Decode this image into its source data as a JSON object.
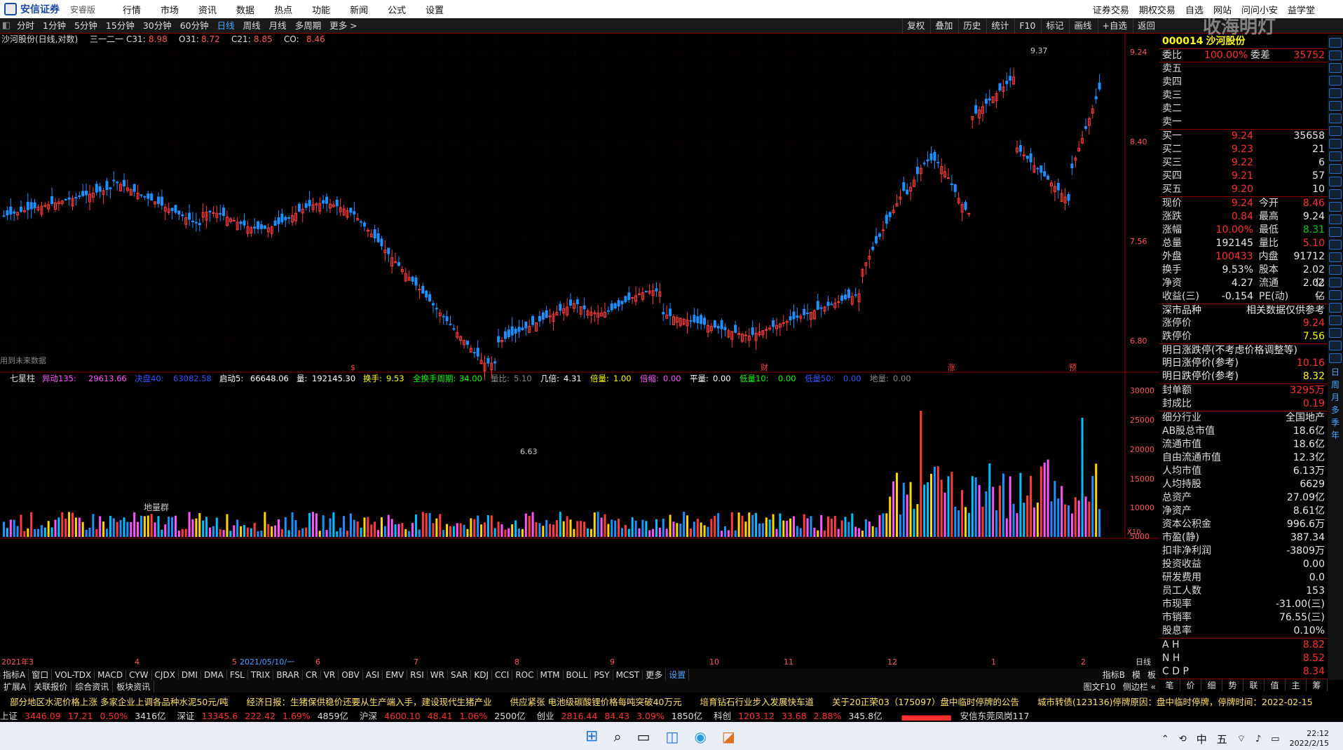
{
  "app": {
    "brand": "安信证券",
    "edition": "安睿版",
    "watermark": "收海明灯"
  },
  "menu": {
    "left": [
      "行情",
      "市场",
      "资讯",
      "数据",
      "热点",
      "功能",
      "新闻",
      "公式",
      "设置"
    ],
    "right": [
      "证券交易",
      "期权交易",
      "自选",
      "网站",
      "问问小安",
      "益学堂"
    ]
  },
  "toolbar": {
    "periods": [
      "分时",
      "1分钟",
      "5分钟",
      "15分钟",
      "30分钟",
      "60分钟",
      "日线",
      "周线",
      "月线",
      "多周期",
      "更多 >"
    ],
    "active": "日线",
    "right": [
      "复权",
      "叠加",
      "历史",
      "统计",
      "F10",
      "标记",
      "画线",
      "+自选",
      "返回"
    ]
  },
  "chart": {
    "title": "沙河股份(日线,对数)",
    "ma_name": "三一二一",
    "legend": [
      {
        "k": "C31:",
        "v": "8.98"
      },
      {
        "k": "O31:",
        "v": "8.72"
      },
      {
        "k": "C21:",
        "v": "8.85"
      },
      {
        "k": "CO:",
        "v": "8.46"
      }
    ],
    "price_ticks": [
      "9.24",
      "8.40",
      "7.56",
      "6.80"
    ],
    "high_mark": "9.37",
    "low_mark": "6.63",
    "note": "用到未来数据",
    "markers": [
      "$",
      "财",
      "涨",
      "预"
    ]
  },
  "indicator": {
    "name": "七星柱",
    "items": [
      {
        "k": "异动135:",
        "v": "29613.66",
        "c": "#ff55ff"
      },
      {
        "k": "决盘40:",
        "v": "63082.58",
        "c": "#3355ff"
      },
      {
        "k": "启动5:",
        "v": "66648.06",
        "c": "#ffffff"
      },
      {
        "k": "量:",
        "v": "192145.30",
        "c": "#ffffff"
      },
      {
        "k": "换手:",
        "v": "9.53",
        "c": "#ffff00"
      },
      {
        "k": "全换手周期:",
        "v": "34.00",
        "c": "#00ff00"
      },
      {
        "k": "量比:",
        "v": "5.10",
        "c": "#888888"
      },
      {
        "k": "几倍:",
        "v": "4.31",
        "c": "#ffffff"
      },
      {
        "k": "倍量:",
        "v": "1.00",
        "c": "#ffff00"
      },
      {
        "k": "倍缩:",
        "v": "0.00",
        "c": "#ff55ff"
      },
      {
        "k": "平量:",
        "v": "0.00",
        "c": "#ffffff"
      },
      {
        "k": "低量10:",
        "v": "0.00",
        "c": "#00ff00"
      },
      {
        "k": "低量50:",
        "v": "0.00",
        "c": "#3355ff"
      },
      {
        "k": "地量:",
        "v": "0.00",
        "c": "#888888"
      }
    ],
    "ticks": [
      "30000",
      "25000",
      "20000",
      "15000",
      "10000",
      "5000",
      "X10"
    ],
    "label": "地量群"
  },
  "xaxis": {
    "labels": [
      "2021年3",
      "4",
      "5",
      "2021/05/10/一",
      "6",
      "7",
      "8",
      "9",
      "10",
      "11",
      "12",
      "1",
      "2"
    ],
    "right": "日线"
  },
  "tabs": {
    "row1": [
      "指标A",
      "窗口",
      "VOL-TDX",
      "MACD",
      "CYW",
      "CJDX",
      "DMI",
      "DMA",
      "FSL",
      "TRIX",
      "BRAR",
      "CR",
      "VR",
      "OBV",
      "ASI",
      "EMV",
      "RSI",
      "WR",
      "SAR",
      "KDJ",
      "CCI",
      "ROC",
      "MTM",
      "BOLL",
      "PSY",
      "MCST",
      "更多",
      "设置"
    ],
    "row1r": [
      "指标B",
      "模",
      "板"
    ],
    "row2": [
      "扩展A",
      "关联报价",
      "综合资讯",
      "板块资讯"
    ],
    "row2r": [
      "图文F10",
      "侧边栏 «"
    ]
  },
  "quote": {
    "code": "000014",
    "name": "沙河股份",
    "wb": {
      "label": "委比",
      "pct": "100.00%",
      "wc_label": "委差",
      "wc": "35752"
    },
    "sells": [
      {
        "l": "卖五",
        "p": "",
        "v": ""
      },
      {
        "l": "卖四",
        "p": "",
        "v": ""
      },
      {
        "l": "卖三",
        "p": "",
        "v": ""
      },
      {
        "l": "卖二",
        "p": "",
        "v": ""
      },
      {
        "l": "卖一",
        "p": "",
        "v": ""
      }
    ],
    "buys": [
      {
        "l": "买一",
        "p": "9.24",
        "v": "35658"
      },
      {
        "l": "买二",
        "p": "9.23",
        "v": "21"
      },
      {
        "l": "买三",
        "p": "9.22",
        "v": "6"
      },
      {
        "l": "买四",
        "p": "9.21",
        "v": "57"
      },
      {
        "l": "买五",
        "p": "9.20",
        "v": "10"
      }
    ],
    "stats": [
      {
        "a": "现价",
        "b": "9.24",
        "c": "今开",
        "d": "8.46"
      },
      {
        "a": "涨跌",
        "b": "0.84",
        "c": "最高",
        "d": "9.24"
      },
      {
        "a": "涨幅",
        "b": "10.00%",
        "c": "最低",
        "d": "8.31"
      },
      {
        "a": "总量",
        "b": "192145",
        "c": "量比",
        "d": "5.10"
      },
      {
        "a": "外盘",
        "b": "100433",
        "c": "内盘",
        "d": "91712"
      },
      {
        "a": "换手",
        "b": "9.53%",
        "c": "股本",
        "d": "2.02亿"
      },
      {
        "a": "净资",
        "b": "4.27",
        "c": "流通",
        "d": "2.02亿"
      },
      {
        "a": "收益(三)",
        "b": "-0.154",
        "c": "PE(动)",
        "d": "—"
      }
    ],
    "market_label": "深市品种",
    "ref_label": "相关数据仅供参考",
    "limits": [
      {
        "l": "涨停价",
        "v": "9.24"
      },
      {
        "l": "跌停价",
        "v": "7.56"
      }
    ],
    "tomorrow": {
      "title": "明日涨跌停(不考虑价格调整等)",
      "up_l": "明日涨停价(参考)",
      "up": "10.16",
      "dn_l": "明日跌停价(参考)",
      "dn": "8.32"
    },
    "seal": [
      {
        "l": "封单额",
        "v": "3295万"
      },
      {
        "l": "封成比",
        "v": "0.19"
      }
    ],
    "fund": [
      {
        "l": "细分行业",
        "v": "全国地产"
      },
      {
        "l": "AB股总市值",
        "v": "18.6亿"
      },
      {
        "l": "流通市值",
        "v": "18.6亿"
      },
      {
        "l": "自由流通市值",
        "v": "12.3亿"
      },
      {
        "l": "人均市值",
        "v": "6.13万"
      },
      {
        "l": "人均持股",
        "v": "6629"
      },
      {
        "l": "总资产",
        "v": "27.09亿"
      },
      {
        "l": "净资产",
        "v": "8.61亿"
      },
      {
        "l": "资本公积金",
        "v": "996.6万"
      },
      {
        "l": "市盈(静)",
        "v": "387.34"
      },
      {
        "l": "扣非净利润",
        "v": "-3809万"
      },
      {
        "l": "投资收益",
        "v": "0.00"
      },
      {
        "l": "研发费用",
        "v": "0.0"
      },
      {
        "l": "员工人数",
        "v": "153"
      },
      {
        "l": "市现率",
        "v": "-31.00(三)"
      },
      {
        "l": "市销率",
        "v": "76.55(三)"
      },
      {
        "l": "股息率",
        "v": "0.10%"
      }
    ],
    "hk": [
      {
        "l": "A H",
        "v": "8.82"
      },
      {
        "l": "N H",
        "v": "8.52"
      },
      {
        "l": "C D P",
        "v": "8.34"
      }
    ],
    "btabs": [
      "笔",
      "价",
      "细",
      "势",
      "联",
      "值",
      "主",
      "筹"
    ]
  },
  "news": [
    "部分地区水泥价格上涨 多家企业上调各品种水泥50元/吨",
    "经济日报：生猪保供稳价还要从生产端入手，建设现代生猪产业",
    "供应紧张 电池级碳酸锂价格每吨突破40万元",
    "培育钻石行业步入发展快车道",
    "关于20正荣03（175097）盘中临时停牌的公告",
    "城市转债(123136)停牌原因：盘中临时停牌，停牌时间：2022-02-15"
  ],
  "indices": [
    {
      "n": "上证",
      "v": "3446.09",
      "c": "17.21",
      "p": "0.50%",
      "a": "3416亿"
    },
    {
      "n": "深证",
      "v": "13345.6",
      "c": "222.42",
      "p": "1.69%",
      "a": "4859亿"
    },
    {
      "n": "沪深",
      "v": "4600.10",
      "c": "48.41",
      "p": "1.06%",
      "a": "2500亿"
    },
    {
      "n": "创业",
      "v": "2816.44",
      "c": "84.43",
      "p": "3.09%",
      "a": "1850亿"
    },
    {
      "n": "科创",
      "v": "1203.12",
      "c": "33.68",
      "p": "2.88%",
      "a": "345.8亿"
    }
  ],
  "station": "安信东莞凤岗117",
  "taskbar": {
    "lang": "中",
    "ime": "五",
    "time": "22:12",
    "date": "2022/2/15"
  },
  "side_icons": [
    "日",
    "周",
    "月",
    "多",
    "季",
    "年"
  ]
}
